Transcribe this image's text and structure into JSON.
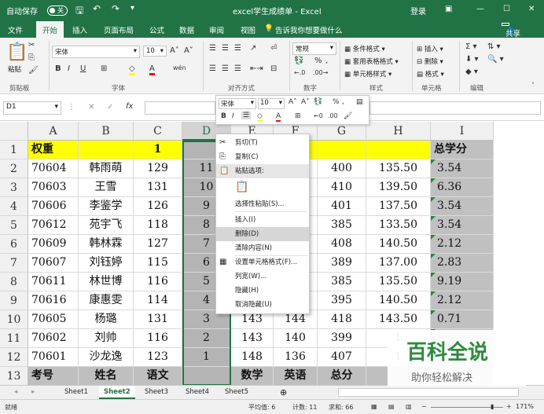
{
  "titlebar": {
    "autosave": "自动保存",
    "autosave_state": "关",
    "title": "excel学生成绩单 - Excel",
    "login": "登录"
  },
  "tabs": [
    "文件",
    "开始",
    "插入",
    "页面布局",
    "公式",
    "数据",
    "审阅",
    "视图"
  ],
  "tellme": "告诉我你想要做什么",
  "share": "共享",
  "ribbon": {
    "paste": "粘贴",
    "font_name": "宋体",
    "font_size": "10",
    "number_format": "常规",
    "cond_format": "条件格式",
    "table_format": "套用表格格式",
    "cell_style": "单元格样式",
    "insert": "插入",
    "delete": "删除",
    "format": "格式",
    "groups": {
      "clipboard": "剪贴板",
      "font": "字体",
      "align": "对齐方式",
      "number": "数字",
      "styles": "样式",
      "cells": "单元格",
      "edit": "编辑"
    }
  },
  "namebox": "D1",
  "fx": "fx",
  "mini": {
    "font": "宋体",
    "size": "10"
  },
  "columns": [
    "A",
    "B",
    "C",
    "D",
    "E",
    "F",
    "G",
    "H",
    "I"
  ],
  "rows": [
    "1",
    "2",
    "3",
    "4",
    "5",
    "6",
    "7",
    "8",
    "9",
    "10",
    "11",
    "12",
    "13"
  ],
  "cells": {
    "A1": "权重",
    "C1": "1",
    "I1": "总学分",
    "A2": "70604",
    "B2": "韩雨萌",
    "C2": "129",
    "D2": "11",
    "F2": "3",
    "G2": "400",
    "H2": "135.50",
    "I2": "3.54",
    "A3": "70603",
    "B3": "王雪",
    "C3": "131",
    "D3": "10",
    "F3": "4",
    "G3": "410",
    "H3": "139.50",
    "I3": "6.36",
    "A4": "70606",
    "B4": "李鉴学",
    "C4": "126",
    "D4": "9",
    "F4": "0",
    "G4": "401",
    "H4": "137.50",
    "I4": "3.54",
    "A5": "70612",
    "B5": "苑宇飞",
    "C5": "118",
    "D5": "8",
    "F5": "1",
    "G5": "385",
    "H5": "133.50",
    "I5": "3.54",
    "A6": "70609",
    "B6": "韩林霖",
    "C6": "127",
    "D6": "7",
    "F6": "2",
    "G6": "408",
    "H6": "140.50",
    "I6": "2.12",
    "A7": "70607",
    "B7": "刘钰婷",
    "C7": "115",
    "D7": "6",
    "F7": "5",
    "G7": "389",
    "H7": "137.00",
    "I7": "2.83",
    "A8": "70611",
    "B8": "林世博",
    "C8": "116",
    "D8": "5",
    "F8": "9",
    "G8": "385",
    "H8": "135.50",
    "I8": "9.19",
    "A9": "70616",
    "B9": "康惠雯",
    "C9": "114",
    "D9": "4",
    "F9": "9",
    "G9": "395",
    "H9": "140.50",
    "I9": "2.12",
    "A10": "70605",
    "B10": "杨璐",
    "C10": "131",
    "D10": "3",
    "E10": "143",
    "F10": "144",
    "G10": "418",
    "H10": "143.50",
    "I10": "0.71",
    "A11": "70602",
    "B11": "刘帅",
    "C11": "116",
    "D11": "2",
    "E11": "143",
    "F11": "140",
    "G11": "399",
    "H11": "1",
    "A12": "70601",
    "B12": "沙龙逸",
    "C12": "123",
    "D12": "1",
    "E12": "148",
    "F12": "136",
    "G12": "407",
    "H12": "1",
    "A13": "考号",
    "B13": "姓名",
    "C13": "语文",
    "E13": "数学",
    "F13": "英语",
    "G13": "总分"
  },
  "context_menu": [
    {
      "label": "剪切(T)",
      "icon": "scissors-icon"
    },
    {
      "label": "复制(C)",
      "icon": "copy-icon"
    },
    {
      "label": "粘贴选项:",
      "icon": "paste-icon"
    },
    {
      "label": "",
      "icon": "clipboard-icon"
    },
    {
      "label": "选择性粘贴(S)...",
      "icon": ""
    },
    {
      "label": "插入(I)",
      "icon": ""
    },
    {
      "label": "删除(D)",
      "icon": ""
    },
    {
      "label": "清除内容(N)",
      "icon": ""
    },
    {
      "label": "设置单元格格式(F)...",
      "icon": "format-cells-icon"
    },
    {
      "label": "列宽(W)...",
      "icon": ""
    },
    {
      "label": "隐藏(H)",
      "icon": ""
    },
    {
      "label": "取消隐藏(U)",
      "icon": ""
    }
  ],
  "sheets": [
    "Sheet1",
    "Sheet2",
    "Sheet3",
    "Sheet4",
    "Sheet5"
  ],
  "active_sheet": "Sheet2",
  "status": {
    "ready": "就绪",
    "avg": "平均值: 6",
    "count": "计数: 11",
    "sum": "求和: 66",
    "zoom": "171%"
  },
  "watermark": {
    "title": "百科全说",
    "subtitle": "助你轻松解决"
  }
}
